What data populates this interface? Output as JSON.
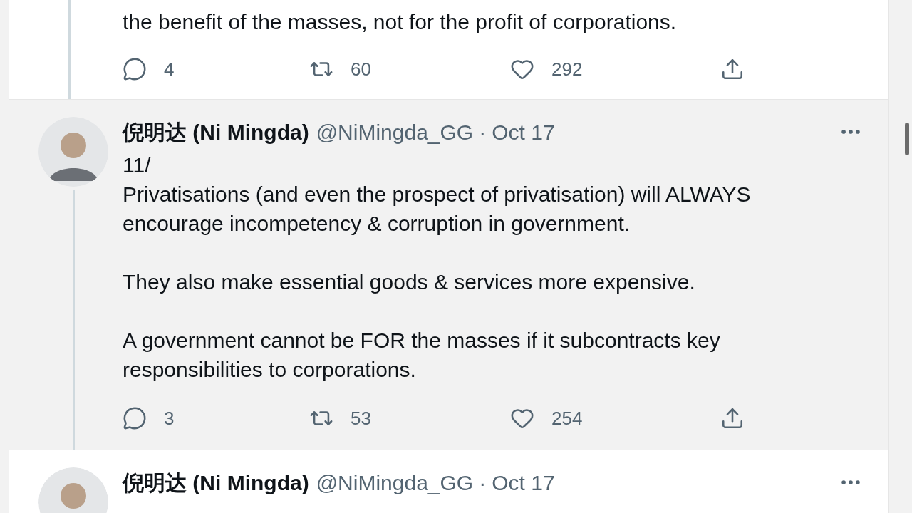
{
  "tweets": [
    {
      "highlighted": false,
      "body": [
        "the benefit of the masses, not for the profit of corporations."
      ],
      "actions": [
        {
          "kind": "reply",
          "count": "4"
        },
        {
          "kind": "retweet",
          "count": "60"
        },
        {
          "kind": "like",
          "count": "292"
        },
        {
          "kind": "share"
        }
      ]
    },
    {
      "highlighted": true,
      "name": "倪明达 (Ni Mingda)",
      "handle": "@NiMingda_GG",
      "separator": "·",
      "date": "Oct 17",
      "body": [
        "11/\nPrivatisations (and even the prospect of privatisation) will ALWAYS encourage incompetency & corruption in government.",
        "They also make essential goods & services more expensive.",
        "A government cannot be FOR the masses if it subcontracts key responsibilities to corporations."
      ],
      "actions": [
        {
          "kind": "reply",
          "count": "3"
        },
        {
          "kind": "retweet",
          "count": "53"
        },
        {
          "kind": "like",
          "count": "254"
        },
        {
          "kind": "share"
        }
      ]
    },
    {
      "highlighted": false,
      "name": "倪明达 (Ni Mingda)",
      "handle": "@NiMingda_GG",
      "separator": "·",
      "date": "Oct 17"
    }
  ]
}
